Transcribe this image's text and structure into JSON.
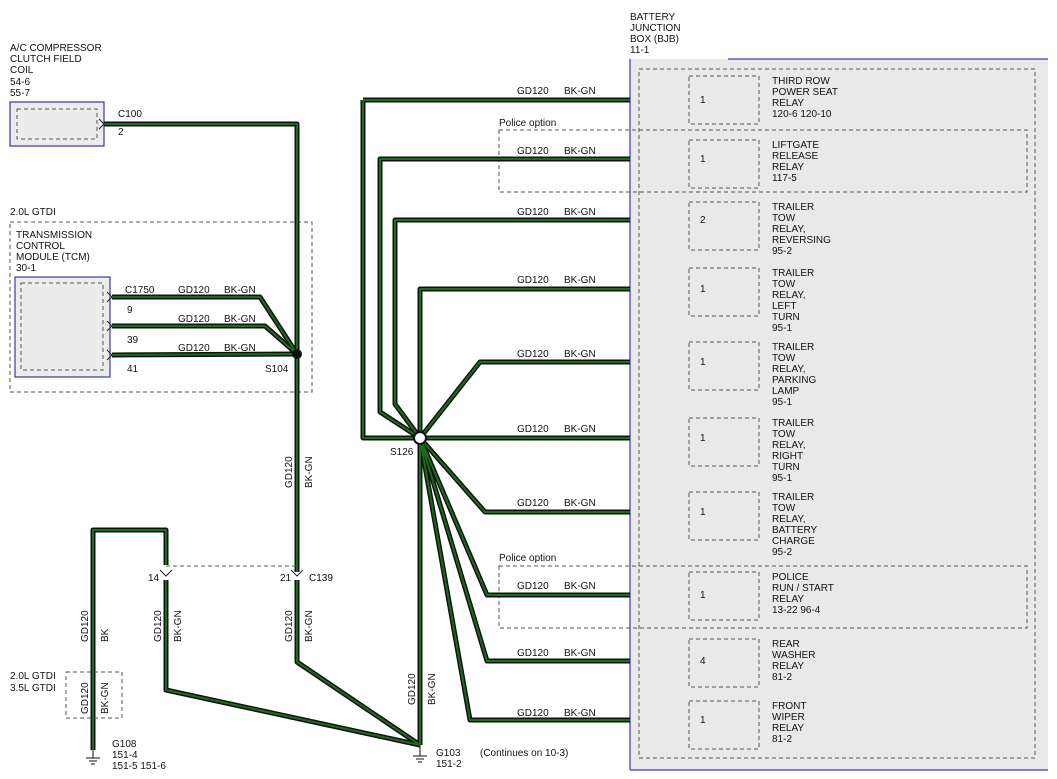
{
  "bjb": {
    "title": [
      "BATTERY",
      "JUNCTION",
      "BOX (BJB)",
      "11-1"
    ],
    "relays": [
      {
        "pin": "1",
        "lines": [
          "THIRD ROW",
          "POWER SEAT",
          "RELAY",
          "120-6    120-10"
        ]
      },
      {
        "pin": "1",
        "lines": [
          "LIFTGATE",
          "RELEASE",
          "RELAY",
          "117-5"
        ]
      },
      {
        "pin": "2",
        "lines": [
          "TRAILER",
          "TOW",
          "RELAY,",
          "REVERSING",
          "95-2"
        ]
      },
      {
        "pin": "1",
        "lines": [
          "TRAILER",
          "TOW",
          "RELAY,",
          "LEFT",
          "TURN",
          "95-1"
        ]
      },
      {
        "pin": "1",
        "lines": [
          "TRAILER",
          "TOW",
          "RELAY,",
          "PARKING",
          "LAMP",
          "95-1"
        ]
      },
      {
        "pin": "1",
        "lines": [
          "TRAILER",
          "TOW",
          "RELAY,",
          "RIGHT",
          "TURN",
          "95-1"
        ]
      },
      {
        "pin": "1",
        "lines": [
          "TRAILER",
          "TOW",
          "RELAY,",
          "BATTERY",
          "CHARGE",
          "95-2"
        ]
      },
      {
        "pin": "1",
        "lines": [
          "POLICE",
          "RUN / START",
          "RELAY",
          "13-22   96-4"
        ]
      },
      {
        "pin": "4",
        "lines": [
          "REAR",
          "WASHER",
          "RELAY",
          "81-2"
        ]
      },
      {
        "pin": "1",
        "lines": [
          "FRONT",
          "WIPER",
          "RELAY",
          "81-2"
        ]
      }
    ],
    "police_option_1": "Police option",
    "police_option_2": "Police option"
  },
  "wire": {
    "gauge": "GD120",
    "color": "BK-GN",
    "color_bk": "BK"
  },
  "ac": {
    "lines": [
      "A/C COMPRESSOR",
      "CLUTCH FIELD",
      "COIL",
      "54-6",
      "55-7"
    ],
    "connector": "C100",
    "pin": "2"
  },
  "tcm": {
    "engine": "2.0L GTDI",
    "lines": [
      "TRANSMISSION",
      "CONTROL",
      "MODULE (TCM)",
      "30-1"
    ],
    "connector": "C1750",
    "pins": [
      "9",
      "39",
      "41"
    ]
  },
  "splices": {
    "s104": "S104",
    "s126": "S126"
  },
  "c139": {
    "connector": "C139",
    "pin_left": "14",
    "pin_right": "21"
  },
  "engine_box": [
    "2.0L GTDI",
    "3.5L GTDI"
  ],
  "grounds": {
    "g108": [
      "G108",
      "151-4",
      "151-5    151-6"
    ],
    "g103": [
      "G103",
      "151-2"
    ]
  },
  "continues": "(Continues on 10-3)"
}
